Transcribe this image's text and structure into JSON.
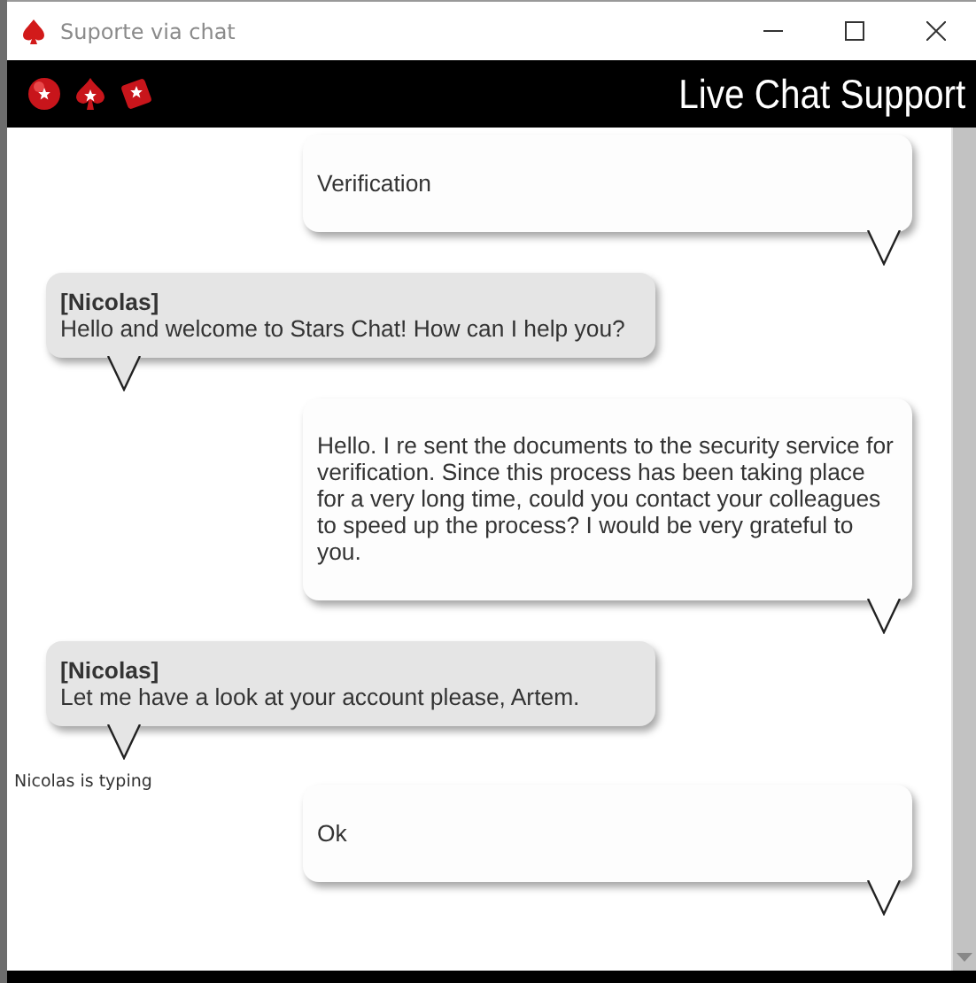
{
  "window": {
    "title": "Suporte via chat"
  },
  "header": {
    "title": "Live Chat Support"
  },
  "messages": [
    {
      "kind": "user",
      "text": "Verification"
    },
    {
      "kind": "agent",
      "sender": "[Nicolas]",
      "text": "Hello and welcome to Stars Chat! How can I help you?"
    },
    {
      "kind": "user",
      "text": "Hello. I re sent the documents to the security service for verification. Since this process has been taking place for a very long time, could you contact your colleagues to speed up the process? I would be very grateful to you."
    },
    {
      "kind": "agent",
      "sender": "[Nicolas]",
      "text": "Let me have a look at your account please, Artem."
    },
    {
      "kind": "status",
      "text": "Nicolas is typing"
    },
    {
      "kind": "user",
      "text": "Ok"
    }
  ]
}
